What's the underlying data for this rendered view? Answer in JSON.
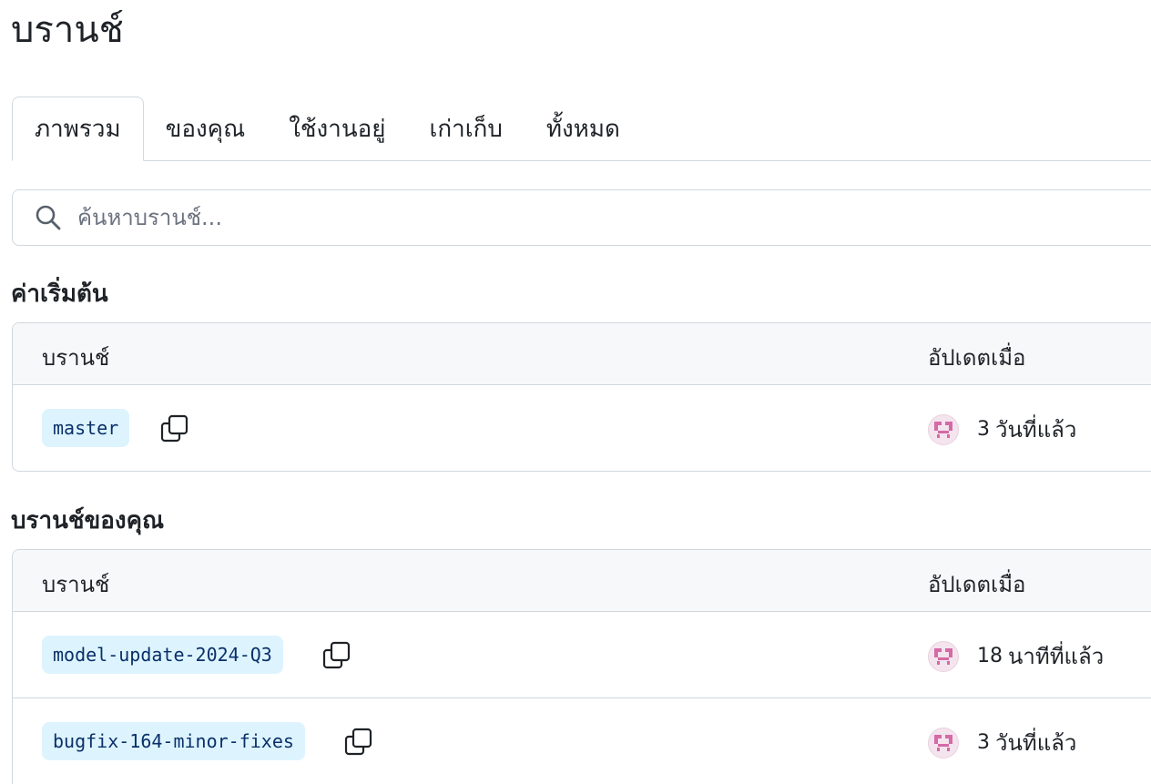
{
  "page": {
    "title": "บรานช์"
  },
  "tabs": [
    {
      "label": "ภาพรวม",
      "active": true
    },
    {
      "label": "ของคุณ",
      "active": false
    },
    {
      "label": "ใช้งานอยู่",
      "active": false
    },
    {
      "label": "เก่าเก็บ",
      "active": false
    },
    {
      "label": "ทั้งหมด",
      "active": false
    }
  ],
  "search": {
    "placeholder": "ค้นหาบรานช์...",
    "value": "",
    "icon": "search-icon"
  },
  "default_section": {
    "heading": "ค่าเริ่มต้น",
    "columns": {
      "branch": "บรานช์",
      "updated": "อัปเดตเมื่อ"
    },
    "rows": [
      {
        "branch": "master",
        "ago_number": "3",
        "ago_unit": "วันที่แล้ว"
      }
    ]
  },
  "yours_section": {
    "heading": "บรานช์ของคุณ",
    "columns": {
      "branch": "บรานช์",
      "updated": "อัปเดตเมื่อ"
    },
    "rows": [
      {
        "branch": "model-update-2024-Q3",
        "ago_number": "18",
        "ago_unit": "นาทีที่แล้ว"
      },
      {
        "branch": "bugfix-164-minor-fixes",
        "ago_number": "3",
        "ago_unit": "วันที่แล้ว"
      }
    ]
  },
  "colors": {
    "chip_bg": "#ddf4ff",
    "chip_text": "#0a3069",
    "border": "#d0d7de",
    "header_bg": "#f6f8fa",
    "avatar": "#d46aa6"
  }
}
